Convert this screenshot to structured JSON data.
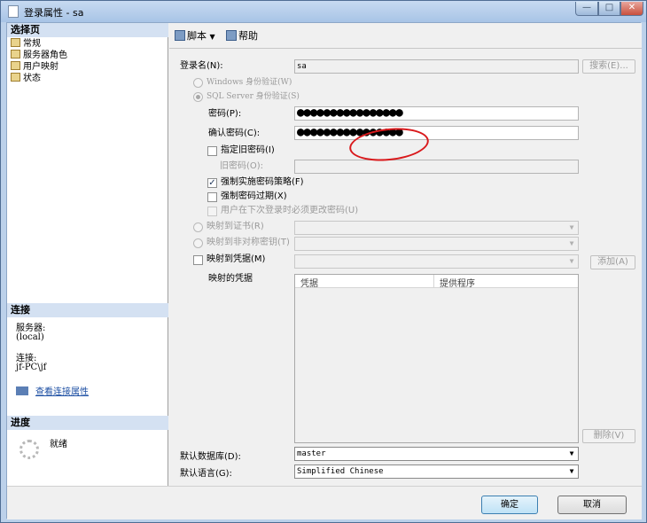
{
  "window": {
    "title": "登录属性 - sa",
    "min": "—",
    "max": "□",
    "close": "✕"
  },
  "left": {
    "select_page_header": "选择页",
    "pages": [
      "常规",
      "服务器角色",
      "用户映射",
      "状态"
    ],
    "connection_header": "连接",
    "server_label": "服务器:",
    "server_value": "(local)",
    "connection_label": "连接:",
    "connection_value": "jf-PC\\jf",
    "view_conn_props": "查看连接属性",
    "progress_header": "进度",
    "progress_status": "就绪"
  },
  "toolbar": {
    "script": "脚本",
    "script_arrow": "▼",
    "help": "帮助"
  },
  "form": {
    "login_name_label": "登录名(N):",
    "login_name_value": "sa",
    "search_button": "搜索(E)...",
    "windows_auth": "Windows 身份验证(W)",
    "sql_auth": "SQL Server 身份验证(S)",
    "password_label": "密码(P):",
    "password_value": "●●●●●●●●●●●●●●●●",
    "confirm_label": "确认密码(C):",
    "confirm_value": "●●●●●●●●●●●●●●●●",
    "specify_old_pwd": "指定旧密码(I)",
    "old_pwd_label": "旧密码(O):",
    "enforce_policy": "强制实施密码策略(F)",
    "enforce_expiry": "强制密码过期(X)",
    "must_change": "用户在下次登录时必须更改密码(U)",
    "map_cert": "映射到证书(R)",
    "map_asym": "映射到非对称密钥(T)",
    "map_cred": "映射到凭据(M)",
    "add_button": "添加(A)",
    "mapped_creds_label": "映射的凭据",
    "grid_col1": "凭据",
    "grid_col2": "提供程序",
    "remove_button": "删除(V)",
    "default_db_label": "默认数据库(D):",
    "default_db_value": "master",
    "default_lang_label": "默认语言(G):",
    "default_lang_value": "Simplified Chinese",
    "check_mark": "✓",
    "arrow": "▼"
  },
  "buttons": {
    "ok": "确定",
    "cancel": "取消"
  },
  "colors": {
    "accent": "#d4e1f2",
    "annotation": "#d9191c"
  }
}
